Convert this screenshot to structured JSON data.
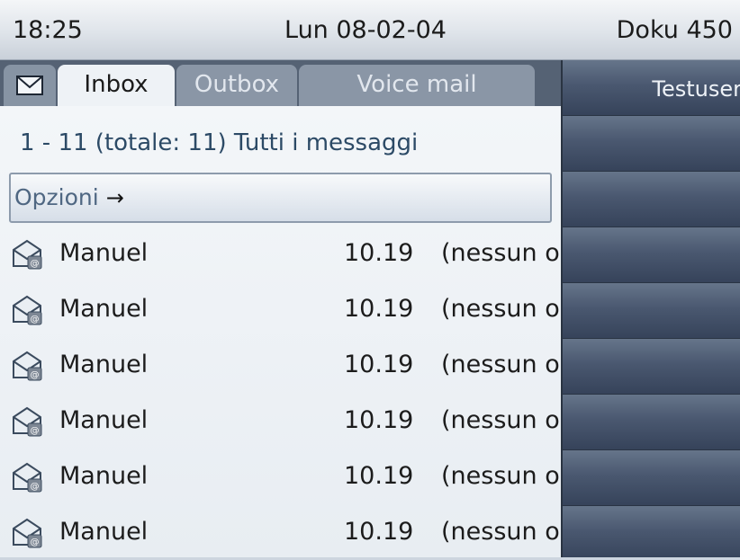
{
  "status": {
    "time": "18:25",
    "date": "Lun 08-02-04",
    "user": "Doku 450"
  },
  "tabs": [
    {
      "label": "Inbox",
      "active": true
    },
    {
      "label": "Outbox",
      "active": false
    },
    {
      "label": "Voice mail",
      "active": false
    }
  ],
  "summary": "1 - 11 (totale: 11) Tutti i messaggi",
  "options": {
    "label": "Opzioni",
    "arrow": "→"
  },
  "messages": [
    {
      "icon": "email-icon",
      "sender": "Manuel",
      "time": "10.19",
      "subject": "(nessun o"
    },
    {
      "icon": "email-icon",
      "sender": "Manuel",
      "time": "10.19",
      "subject": "(nessun o"
    },
    {
      "icon": "email-icon",
      "sender": "Manuel",
      "time": "10.19",
      "subject": "(nessun o"
    },
    {
      "icon": "email-icon",
      "sender": "Manuel",
      "time": "10.19",
      "subject": "(nessun o"
    },
    {
      "icon": "email-icon",
      "sender": "Manuel",
      "time": "10.19",
      "subject": "(nessun o"
    },
    {
      "icon": "email-icon",
      "sender": "Manuel",
      "time": "10.19",
      "subject": "(nessun o"
    }
  ],
  "right_panel": {
    "user": "Testuser"
  },
  "colors": {
    "accent": "#556274",
    "summary_text": "#2c4a66",
    "panel": "#3a475a"
  }
}
